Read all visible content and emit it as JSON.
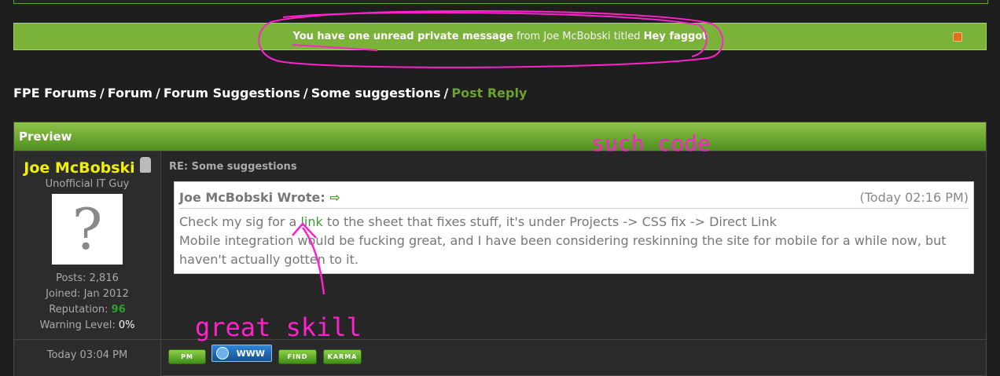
{
  "pm_notice": {
    "lead": "You have one unread private message",
    "from_text": "from Joe McBobski titled",
    "title": "Hey faggot"
  },
  "breadcrumb": {
    "items": [
      "FPE Forums",
      "Forum",
      "Forum Suggestions",
      "Some suggestions"
    ],
    "current": "Post Reply",
    "separator": "/"
  },
  "preview": {
    "header": "Preview",
    "author": {
      "name": "Joe McBobski",
      "title": "Unofficial IT Guy",
      "avatar_glyph": "?",
      "posts_label": "Posts:",
      "posts": "2,816",
      "joined_label": "Joined:",
      "joined": "Jan 2012",
      "reputation_label": "Reputation:",
      "reputation": "96",
      "warning_label": "Warning Level:",
      "warning": "0%"
    },
    "subject": "RE: Some suggestions",
    "quote": {
      "author": "Joe McBobski Wrote:",
      "arrow": "⇨",
      "time": "(Today 02:16 PM)",
      "line1_pre": "Check my sig for a",
      "line1_link": "link",
      "line1_post": "to the sheet that fixes stuff, it's under Projects -> CSS fix -> Direct Link",
      "line2": "Mobile integration would be fucking great, and I have been considering reskinning the site for mobile for a while now, but haven't actually gotten to it."
    },
    "post_time": "Today 03:04 PM",
    "buttons": {
      "pm": "PM",
      "www": "WWW",
      "find": "FIND",
      "karma": "KARMA"
    }
  },
  "annotations": {
    "such_code": "such code",
    "great_skill": "great skill"
  },
  "colors": {
    "accent_green": "#7bb239",
    "author_yellow": "#f0f000",
    "scribble_magenta": "#ff22cc"
  }
}
